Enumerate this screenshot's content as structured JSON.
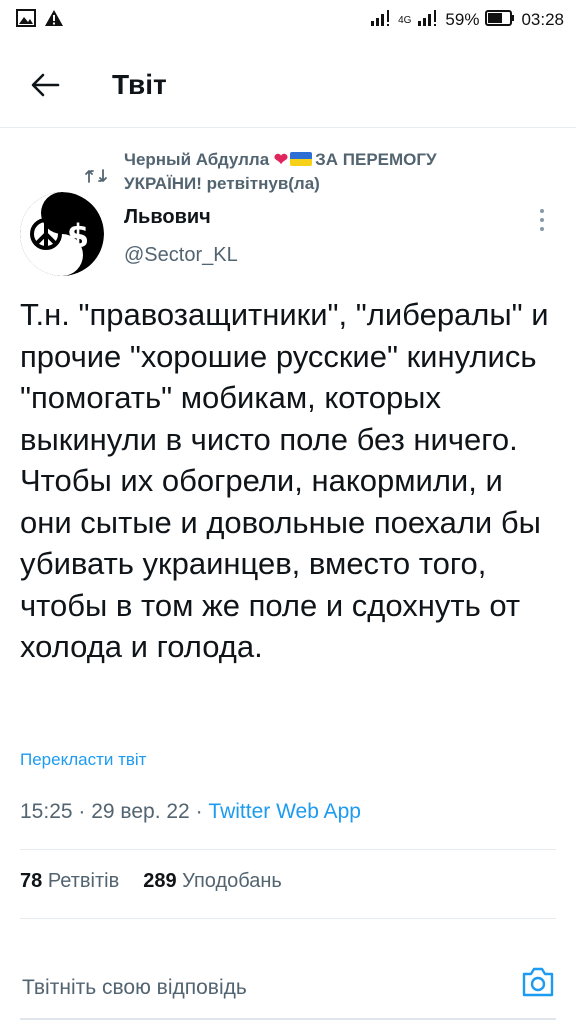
{
  "status_bar": {
    "signal_label": "4G",
    "battery": "59%",
    "time": "03:28",
    "icons": [
      "gallery-icon",
      "warning-icon",
      "signal-icon",
      "battery-icon"
    ]
  },
  "app_bar": {
    "title": "Твіт",
    "back_icon": "arrow-left-icon"
  },
  "retweet": {
    "retweeter": "Черный Абдулла",
    "slogan": "ЗА ПЕРЕМОГУ УКРАЇНИ!",
    "action": "ретвітнув(ла)"
  },
  "author": {
    "name": "Львович",
    "handle": "@Sector_KL"
  },
  "tweet": {
    "text": "Т.н. \"правозащитники\", \"либералы\" и прочие \"хорошие русские\" кинулись \"помогать\" мобикам, которых выкинули в чисто поле без ничего. Чтобы их обогрели, накормили, и они сытые и довольные поехали бы убивать украинцев, вместо того, чтобы в том же поле и сдохнуть от холода и голода.",
    "translate_label": "Перекласти твіт",
    "time": "15:25",
    "date": "29 вер. 22",
    "client": "Twitter Web App"
  },
  "stats": {
    "retweets_count": "78",
    "retweets_label": "Ретвітів",
    "likes_count": "289",
    "likes_label": "Уподобань"
  },
  "reply": {
    "placeholder": "Твітніть свою відповідь"
  },
  "colors": {
    "accent": "#1d9bf0",
    "muted": "#536471",
    "heart": "#e0245e"
  }
}
